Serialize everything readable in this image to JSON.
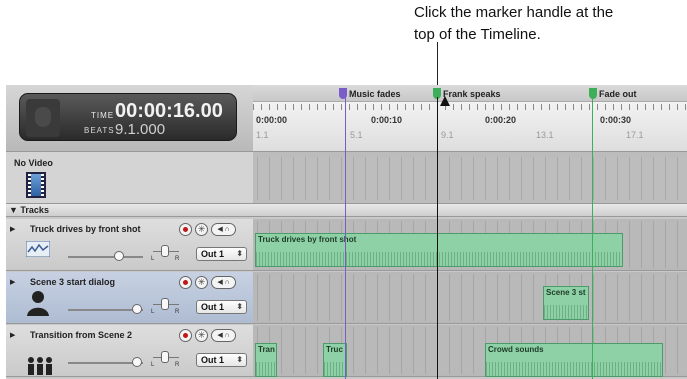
{
  "callout": {
    "line1": "Click the marker handle at the",
    "line2": "top of the Timeline."
  },
  "lcd": {
    "time_label": "TIME",
    "time_value": "00:00:16.00",
    "beats_label": "BEATS",
    "beats_value": "9.1.000"
  },
  "markers": [
    {
      "label": "Music fades",
      "color": "#7a5cc8"
    },
    {
      "label": "Frank speaks",
      "color": "#3fae5a"
    },
    {
      "label": "Fade out",
      "color": "#3fae5a"
    }
  ],
  "ruler": {
    "times": [
      "0:00:00",
      "0:00:10",
      "0:00:20",
      "0:00:30"
    ],
    "beats": [
      "1.1",
      "5.1",
      "9.1",
      "13.1",
      "17.1"
    ]
  },
  "video": {
    "label": "No Video",
    "icon": "film-icon"
  },
  "tracks_header": "Tracks",
  "tracks": [
    {
      "name": "Truck drives by front shot",
      "output": "Out 1",
      "icon": "waveform-icon"
    },
    {
      "name": "Scene 3 start dialog",
      "output": "Out 1",
      "icon": "person-icon"
    },
    {
      "name": "Transition from Scene 2",
      "output": "Out 1",
      "icon": "crowd-icon"
    }
  ],
  "regions": {
    "r1": "Truck drives by front shot",
    "r2": "Scene 3 st",
    "r3a": "Tran",
    "r3b": "Truc",
    "r3c": "Crowd sounds"
  },
  "colors": {
    "region_fill": "#8fd1a6",
    "marker_purple": "#7a5cc8",
    "marker_green": "#3fae5a",
    "record": "#c01818"
  }
}
